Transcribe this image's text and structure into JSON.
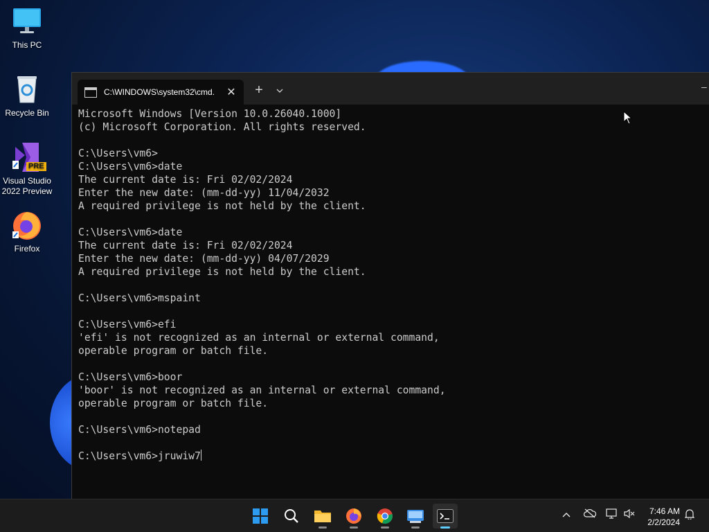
{
  "desktop": {
    "icons": [
      {
        "label": "This PC",
        "icon": "monitor-icon"
      },
      {
        "label": "Recycle Bin",
        "icon": "recycle-bin-icon"
      },
      {
        "label": "Visual Studio 2022 Preview",
        "line1": "Visual Studio",
        "line2": "2022 Preview",
        "badge": "PRE",
        "icon": "visual-studio-icon"
      },
      {
        "label": "Firefox",
        "icon": "firefox-icon"
      }
    ]
  },
  "terminal": {
    "tab_title": "C:\\WINDOWS\\system32\\cmd.",
    "new_tab_symbol": "+",
    "dropdown_symbol": "⌄",
    "minimize_symbol": "–",
    "lines": [
      "Microsoft Windows [Version 10.0.26040.1000]",
      "(c) Microsoft Corporation. All rights reserved.",
      "",
      "C:\\Users\\vm6>",
      "C:\\Users\\vm6>date",
      "The current date is: Fri 02/02/2024",
      "Enter the new date: (mm-dd-yy) 11/04/2032",
      "A required privilege is not held by the client.",
      "",
      "C:\\Users\\vm6>date",
      "The current date is: Fri 02/02/2024",
      "Enter the new date: (mm-dd-yy) 04/07/2029",
      "A required privilege is not held by the client.",
      "",
      "C:\\Users\\vm6>mspaint",
      "",
      "C:\\Users\\vm6>efi",
      "'efi' is not recognized as an internal or external command,",
      "operable program or batch file.",
      "",
      "C:\\Users\\vm6>boor",
      "'boor' is not recognized as an internal or external command,",
      "operable program or batch file.",
      "",
      "C:\\Users\\vm6>notepad",
      ""
    ],
    "prompt": "C:\\Users\\vm6>",
    "current_input": "jruwiw7"
  },
  "taskbar": {
    "apps": [
      "start-icon",
      "search-icon",
      "file-explorer-icon",
      "firefox-icon",
      "chrome-icon",
      "remote-desktop-icon",
      "terminal-icon"
    ],
    "active_app": "terminal-icon",
    "tray_expand_symbol": "^",
    "time": "7:46 AM",
    "date": "2/2/2024"
  },
  "colors": {
    "terminal_bg": "#0c0c0c",
    "terminal_text": "#cccccc",
    "titlebar_bg": "#202020",
    "taskbar_bg": "#1c1c1c",
    "accent": "#60cdff"
  }
}
